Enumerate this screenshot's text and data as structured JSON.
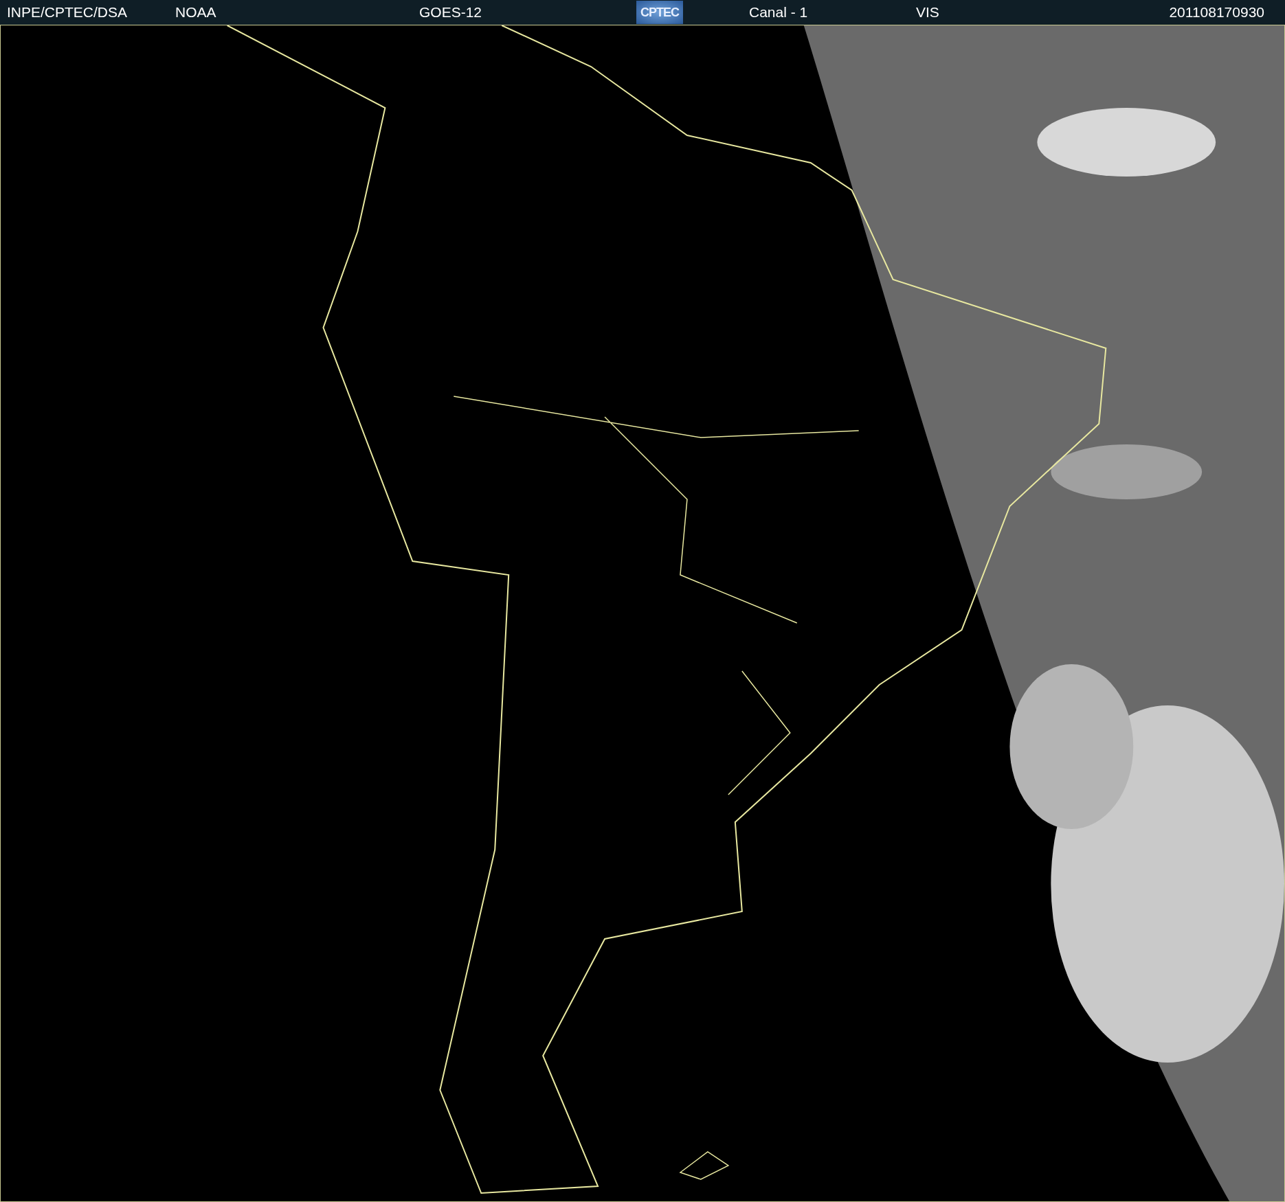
{
  "header": {
    "source": "INPE/CPTEC/DSA",
    "agency": "NOAA",
    "satellite": "GOES-12",
    "logo_text": "CPTEC",
    "channel": "Canal - 1",
    "band": "VIS",
    "timestamp": "201108170930"
  }
}
